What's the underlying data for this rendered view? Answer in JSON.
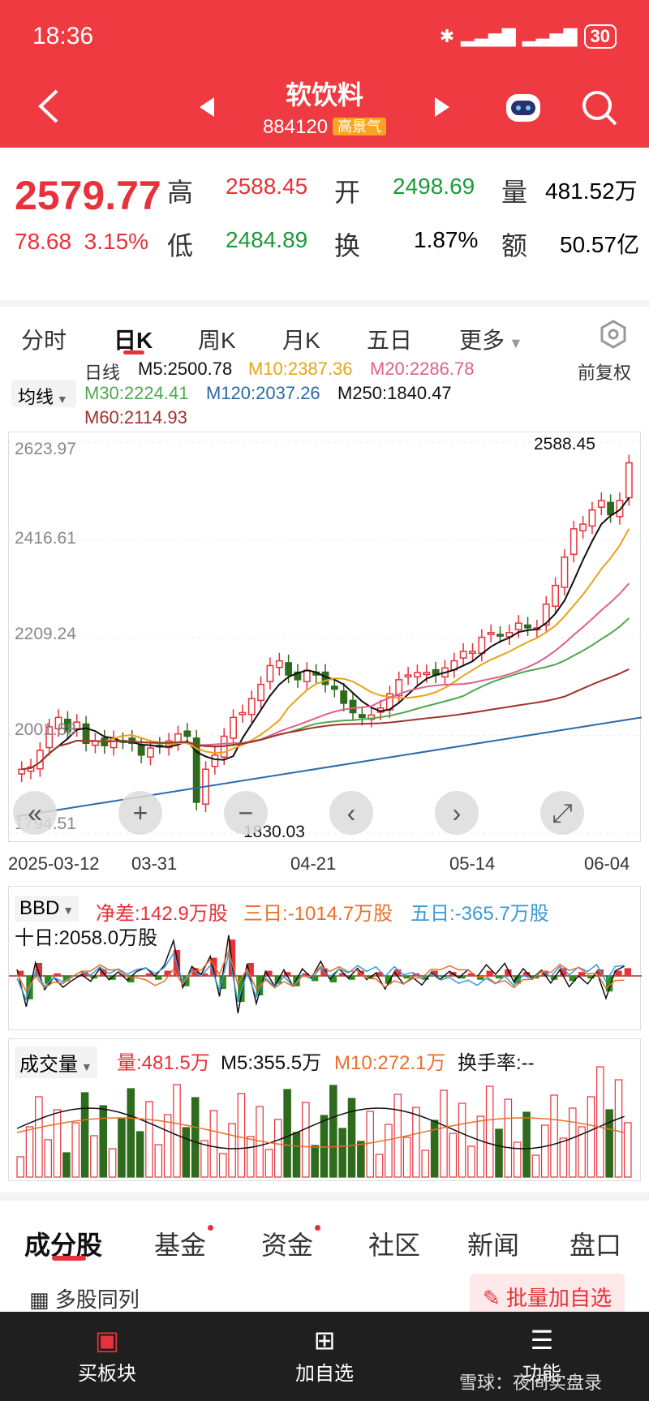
{
  "status": {
    "time": "18:36",
    "battery": "30"
  },
  "header": {
    "title": "软饮料",
    "code": "884120",
    "badge": "高景气"
  },
  "quote": {
    "price": "2579.77",
    "change": "78.68",
    "change_pct": "3.15%",
    "high_label": "高",
    "high": "2588.45",
    "low_label": "低",
    "low": "2484.89",
    "open_label": "开",
    "open": "2498.69",
    "turn_label": "换",
    "turnover": "1.87%",
    "vol_label": "量",
    "volume": "481.52万",
    "amt_label": "额",
    "amount": "50.57亿"
  },
  "tabs": [
    "分时",
    "日K",
    "周K",
    "月K",
    "五日",
    "更多"
  ],
  "ma": {
    "selector": "均线",
    "period": "日线",
    "fq": "前复权",
    "m5": "M5:2500.78",
    "m10": "M10:2387.36",
    "m20": "M20:2286.78",
    "m30": "M30:2224.41",
    "m120": "M120:2037.26",
    "m250": "M250:1840.47",
    "m60": "M60:2114.93"
  },
  "colors": {
    "up": "#e8313a",
    "down": "#2e6b1c",
    "m5": "#111111",
    "m10": "#e8a317",
    "m20": "#e0608a",
    "m30": "#4fa84f",
    "m60": "#a0322a",
    "m120": "#2b6aa8"
  },
  "chart_data": [
    {
      "type": "candlestick",
      "y_ticks": [
        "2623.97",
        "2416.61",
        "2209.24",
        "2001.88",
        "1794.51"
      ],
      "x_ticks": [
        "2025-03-12",
        "03-31",
        "04-21",
        "05-14",
        "06-04"
      ],
      "ylim": [
        1794.51,
        2623.97
      ],
      "annotations": {
        "high": "2588.45",
        "low": "1830.03"
      },
      "close": [
        1930,
        1935,
        1970,
        2020,
        2040,
        2010,
        2030,
        1985,
        1990,
        1980,
        1995,
        1990,
        1985,
        1960,
        1975,
        1980,
        1990,
        2005,
        2000,
        1860,
        1930,
        1960,
        2000,
        2040,
        2050,
        2080,
        2110,
        2150,
        2160,
        2130,
        2120,
        2140,
        2130,
        2110,
        2100,
        2070,
        2050,
        2040,
        2045,
        2060,
        2090,
        2120,
        2130,
        2135,
        2135,
        2130,
        2145,
        2160,
        2180,
        2180,
        2210,
        2220,
        2215,
        2220,
        2240,
        2230,
        2230,
        2280,
        2320,
        2380,
        2440,
        2450,
        2480,
        2500,
        2470,
        2500,
        2580
      ]
    },
    {
      "type": "bar",
      "title": "BBD",
      "labels": {
        "net": "净差:142.9万股",
        "d3": "三日:-1014.7万股",
        "d5": "五日:-365.7万股",
        "d10": "十日:2058.0万股"
      }
    },
    {
      "type": "bar",
      "title": "成交量",
      "labels": {
        "vol": "量:481.5万",
        "m5": "M5:355.5万",
        "m10": "M10:272.1万",
        "turn": "换手率:--"
      }
    }
  ],
  "bottom_tabs": [
    "成分股",
    "基金",
    "资金",
    "社区",
    "新闻",
    "盘口"
  ],
  "multi_label": "多股同列",
  "batch_label": "批量加自选",
  "nav": [
    "买板块",
    "加自选",
    "功能"
  ],
  "watermark": "雪球：夜间实盘录"
}
